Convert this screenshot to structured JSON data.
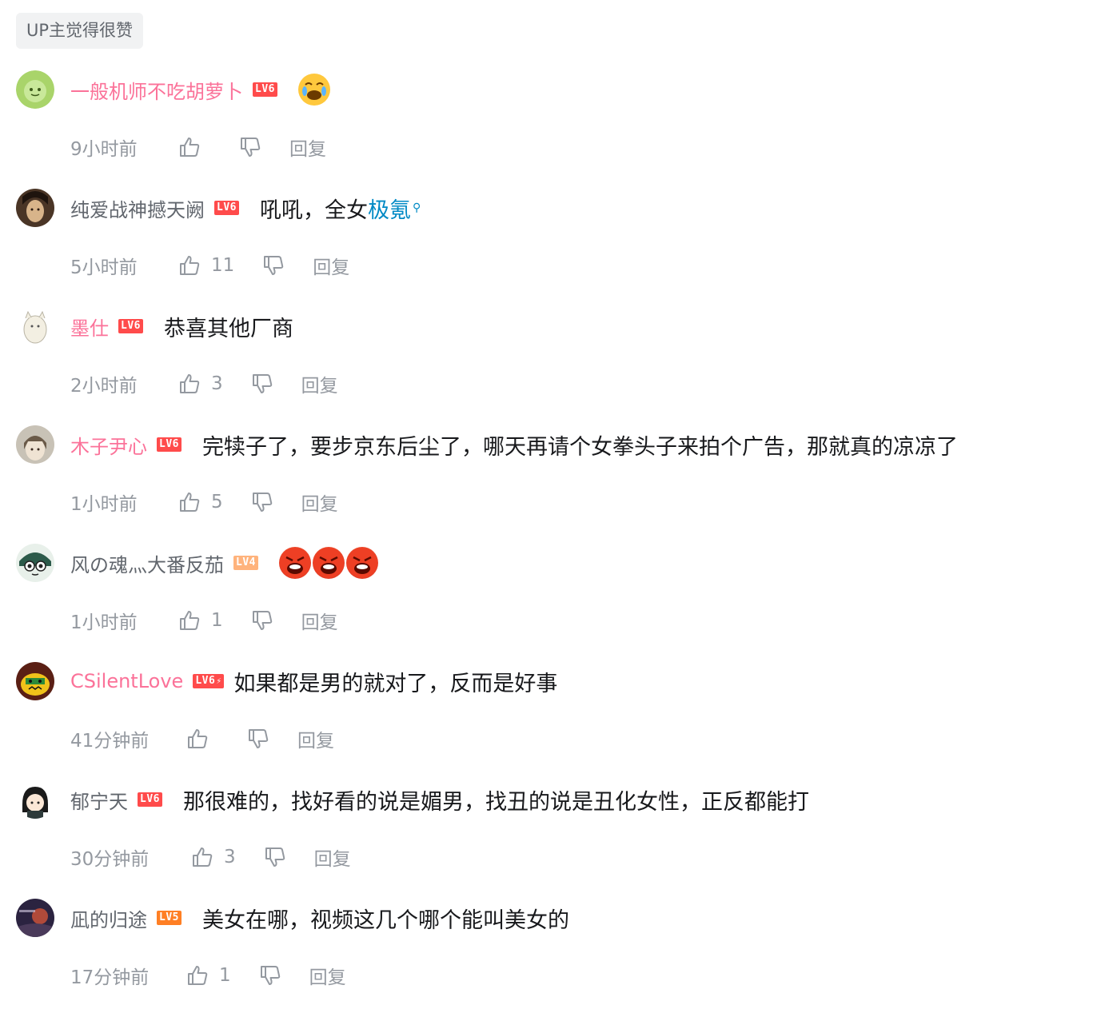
{
  "tag": "UP主觉得很赞",
  "comments": [
    {
      "user": "一般机师不吃胡萝卜",
      "level": "LV6",
      "content": "",
      "emojis": [
        "cry-laugh"
      ],
      "time": "9小时前",
      "likes": "",
      "reply": "回复"
    },
    {
      "user": "纯爱战神撼天阙",
      "level": "LV6",
      "content": "吼吼，全女",
      "link": "极氪",
      "time": "5小时前",
      "likes": "11",
      "reply": "回复"
    },
    {
      "user": "墨仕",
      "level": "LV6",
      "content": "恭喜其他厂商",
      "time": "2小时前",
      "likes": "3",
      "reply": "回复"
    },
    {
      "user": "木子尹心",
      "level": "LV6",
      "content": "完犊子了，要步京东后尘了，哪天再请个女拳头子来拍个广告，那就真的凉凉了",
      "time": "1小时前",
      "likes": "5",
      "reply": "回复"
    },
    {
      "user": "风の魂灬大番反茄",
      "level": "LV4",
      "content": "",
      "emojis": [
        "angry",
        "angry",
        "angry"
      ],
      "time": "1小时前",
      "likes": "1",
      "reply": "回复"
    },
    {
      "user": "CSilentLove",
      "level": "LV6",
      "content": "如果都是男的就对了，反而是好事",
      "time": "41分钟前",
      "likes": "",
      "reply": "回复"
    },
    {
      "user": "郁宁天",
      "level": "LV6",
      "content": "那很难的，找好看的说是媚男，找丑的说是丑化女性，正反都能打",
      "time": "30分钟前",
      "likes": "3",
      "reply": "回复"
    },
    {
      "user": "凪的归途",
      "level": "LV5",
      "content": "美女在哪，视频这几个哪个能叫美女的",
      "time": "17分钟前",
      "likes": "1",
      "reply": "回复"
    }
  ]
}
